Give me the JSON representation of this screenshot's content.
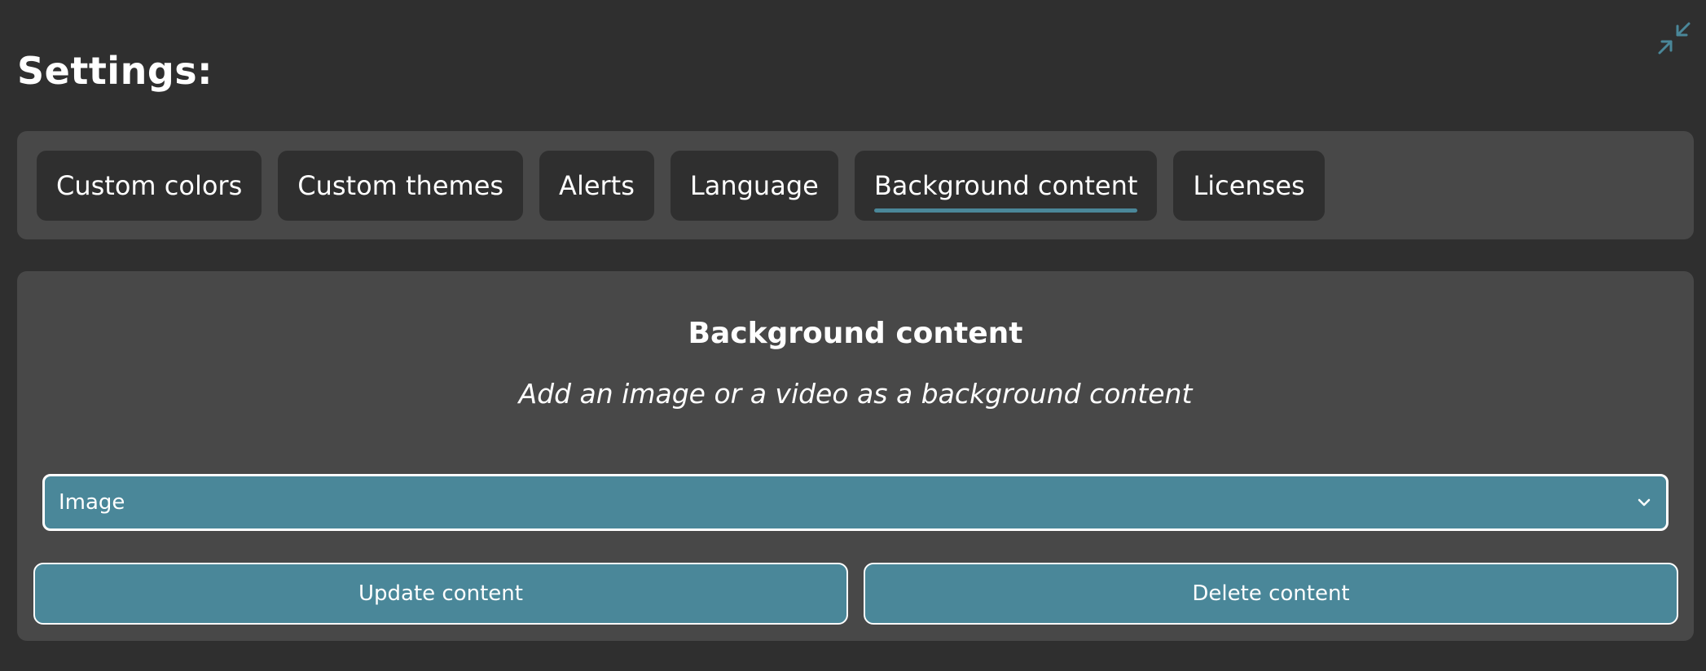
{
  "header": {
    "title": "Settings:",
    "minimize_icon": "minimize-arrows-icon"
  },
  "tabs": [
    {
      "label": "Custom colors",
      "active": false
    },
    {
      "label": "Custom themes",
      "active": false
    },
    {
      "label": "Alerts",
      "active": false
    },
    {
      "label": "Language",
      "active": false
    },
    {
      "label": "Background content",
      "active": true
    },
    {
      "label": "Licenses",
      "active": false
    }
  ],
  "panel": {
    "title": "Background content",
    "subtitle": "Add an image or a video as a background content",
    "content_type_select": {
      "selected": "Image"
    },
    "update_button": "Update content",
    "delete_button": "Delete content"
  },
  "colors": {
    "background": "#2f2f2f",
    "panel": "#484848",
    "accent": "#4a8799",
    "text": "#ffffff"
  }
}
